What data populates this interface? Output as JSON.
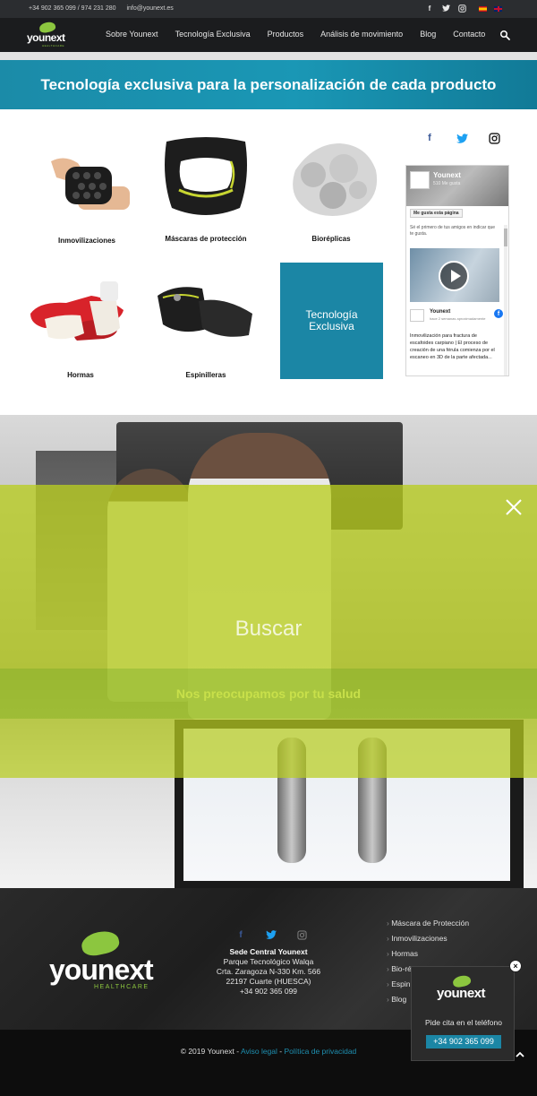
{
  "topbar": {
    "phone": "+34 902 365 099 / 974 231 280",
    "email": "info@younext.es",
    "socials": [
      {
        "icon": "facebook-icon",
        "glyph": "f"
      },
      {
        "icon": "twitter-icon",
        "glyph": "t"
      },
      {
        "icon": "instagram-icon",
        "glyph": "◎"
      }
    ]
  },
  "brand": {
    "name": "younext",
    "tagline": "HEALTHCARE",
    "accent": "#8cc63f",
    "teal": "#1b86a5"
  },
  "nav": {
    "items": [
      "Sobre Younext",
      "Tecnología Exclusiva",
      "Productos",
      "Análisis de movimiento",
      "Blog",
      "Contacto"
    ]
  },
  "banner": {
    "title": "Tecnología exclusiva para la personalización de cada producto"
  },
  "products": [
    {
      "label": "Inmovilizaciones"
    },
    {
      "label": "Máscaras de protección"
    },
    {
      "label": "Bioréplicas"
    },
    {
      "label": "Hormas"
    },
    {
      "label": "Espinilleras"
    }
  ],
  "tech_box": {
    "line1": "Tecnología",
    "line2": "Exclusiva"
  },
  "facebook_widget": {
    "page_name": "Younext",
    "likes": "510 Me gusta",
    "like_button": "Me gusta esta página",
    "friends_text": "Sé el primero de tus amigos en indicar que te gusta.",
    "post_author": "Younext",
    "post_time": "hace 2 semanas aproximadamente",
    "post_text": "Inmovilización para fractura de escafoides carpiano | El proceso de creación de una férula comienza por el escaneo en 3D de la parte afectada..."
  },
  "search_overlay": {
    "placeholder": "Buscar",
    "headline": "Nos preocupamos por tu salud"
  },
  "footer": {
    "hq_title": "Sede Central Younext",
    "address_lines": [
      "Parque Tecnológico Walqa",
      "Crta. Zaragoza N-330 Km. 566",
      "22197 Cuarte (HUESCA)",
      "+34 902 365 099"
    ],
    "links": [
      "Máscara de Protección",
      "Inmovilizaciones",
      "Hormas",
      "Bio-réplicas",
      "Espinilleras",
      "Blog"
    ],
    "copyright": "© 2019 Younext -",
    "legal": "Aviso legal",
    "privacy": "Política de privacidad"
  },
  "popup": {
    "text": "Pide cita en el  teléfono",
    "phone": "+34 902 365 099"
  }
}
